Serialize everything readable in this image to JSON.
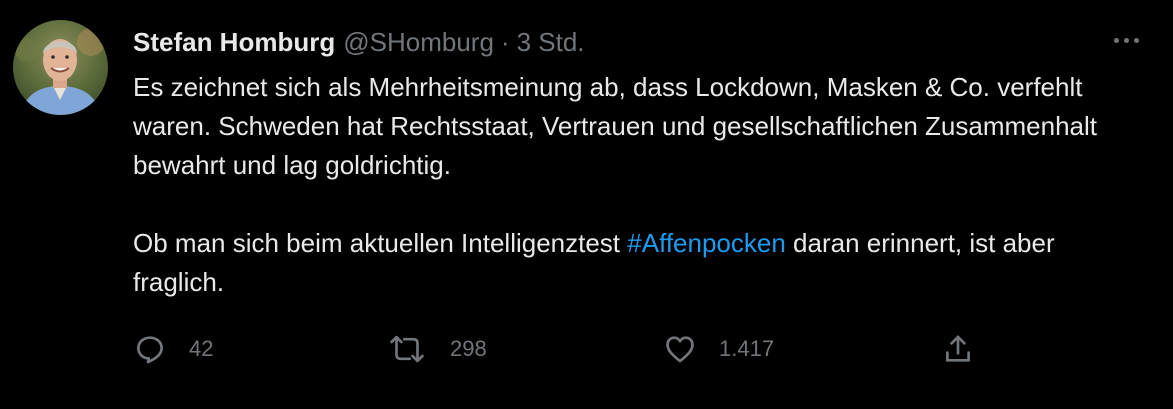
{
  "author": {
    "display_name": "Stefan Homburg",
    "handle": "@SHomburg",
    "separator": "·",
    "timestamp": "3 Std."
  },
  "tweet": {
    "paragraph1": "Es zeichnet sich als Mehrheitsmeinung ab, dass Lockdown, Masken & Co. verfehlt waren. Schweden hat Rechtsstaat, Vertrauen und gesellschaftlichen Zusammenhalt bewahrt und lag goldrichtig.",
    "paragraph2_before": "Ob man sich beim aktuellen Intelligenztest ",
    "hashtag": "#Affenpocken",
    "paragraph2_after": " daran erinnert, ist aber fraglich."
  },
  "actions": {
    "replies": "42",
    "retweets": "298",
    "likes": "1.417"
  },
  "icons": {
    "more": "more-horizontal-icon",
    "reply": "reply-icon",
    "retweet": "retweet-icon",
    "like": "heart-icon",
    "share": "share-icon"
  },
  "colors": {
    "background": "#000000",
    "text": "#e7e9ea",
    "secondary": "#71767b",
    "link": "#1d9bf0"
  }
}
